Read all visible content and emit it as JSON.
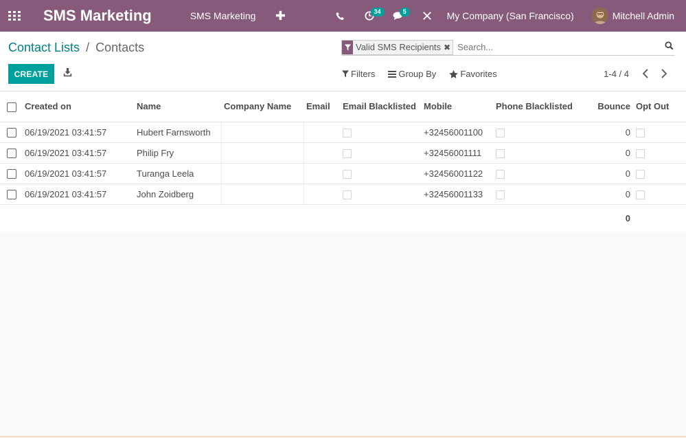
{
  "navbar": {
    "brand": "SMS Marketing",
    "menu_item": "SMS Marketing",
    "activity_count": "34",
    "message_count": "5",
    "company": "My Company (San Francisco)",
    "user": "Mitchell Admin"
  },
  "breadcrumb": {
    "parent": "Contact Lists",
    "separator": "/",
    "current": "Contacts"
  },
  "search": {
    "facet_label": "Valid SMS Recipients",
    "placeholder": "Search..."
  },
  "toolbar": {
    "create_label": "CREATE",
    "filters_label": "Filters",
    "groupby_label": "Group By",
    "favorites_label": "Favorites",
    "pager": "1-4 / 4"
  },
  "table": {
    "headers": {
      "created_on": "Created on",
      "name": "Name",
      "company": "Company Name",
      "email": "Email",
      "email_blacklisted": "Email Blacklisted",
      "mobile": "Mobile",
      "phone_blacklisted": "Phone Blacklisted",
      "bounce": "Bounce",
      "opt_out": "Opt Out"
    },
    "rows": [
      {
        "created_on": "06/19/2021 03:41:57",
        "name": "Hubert Farnsworth",
        "company": "",
        "email": "",
        "mobile": "+32456001100",
        "bounce": "0"
      },
      {
        "created_on": "06/19/2021 03:41:57",
        "name": "Philip Fry",
        "company": "",
        "email": "",
        "mobile": "+32456001111",
        "bounce": "0"
      },
      {
        "created_on": "06/19/2021 03:41:57",
        "name": "Turanga Leela",
        "company": "",
        "email": "",
        "mobile": "+32456001122",
        "bounce": "0"
      },
      {
        "created_on": "06/19/2021 03:41:57",
        "name": "John Zoidberg",
        "company": "",
        "email": "",
        "mobile": "+32456001133",
        "bounce": "0"
      }
    ],
    "footer_bounce_total": "0"
  },
  "colors": {
    "brand": "#875a7b",
    "accent": "#00a09d",
    "link": "#017e84"
  }
}
